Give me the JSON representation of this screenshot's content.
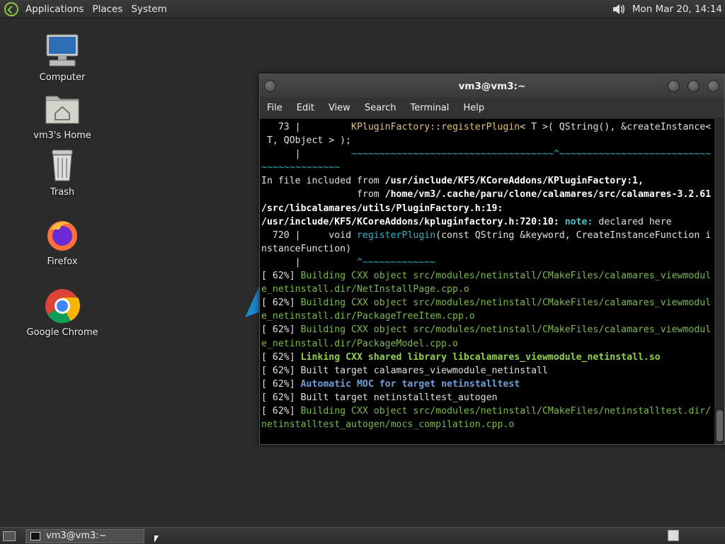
{
  "top_panel": {
    "menus": [
      "Applications",
      "Places",
      "System"
    ],
    "clock": "Mon Mar 20, 14:14"
  },
  "desktop": {
    "icons": [
      {
        "label": "Computer",
        "icon": "computer-icon"
      },
      {
        "label": "vm3's Home",
        "icon": "home-folder-icon"
      },
      {
        "label": "Trash",
        "icon": "trash-icon"
      },
      {
        "label": "Firefox",
        "icon": "firefox-icon"
      },
      {
        "label": "Google Chrome",
        "icon": "chrome-icon"
      }
    ]
  },
  "terminal": {
    "title": "vm3@vm3:~",
    "menu": [
      "File",
      "Edit",
      "View",
      "Search",
      "Terminal",
      "Help"
    ],
    "lines": [
      "   73 |         KPluginFactory::registerPlugin< T >( QString(), &createInstance<",
      " T, QObject > );",
      "      |         ~~~~~~~~~~~~~~~~~~~~~~~~~~~~~~~~~~~~^~~~~~~~~~~~~~~~~~~~~~~~~~~~",
      "~~~~~~~~~~~~~~",
      "In file included from /usr/include/KF5/KCoreAddons/KPluginFactory:1,",
      "                 from /home/vm3/.cache/paru/clone/calamares/src/calamares-3.2.61",
      "/src/libcalamares/utils/PluginFactory.h:19:",
      "/usr/include/KF5/KCoreAddons/kpluginfactory.h:720:10: note: declared here",
      "  720 |     void registerPlugin(const QString &keyword, CreateInstanceFunction i",
      "nstanceFunction)",
      "      |          ^~~~~~~~~~~~~~",
      "[ 62%] Building CXX object src/modules/netinstall/CMakeFiles/calamares_viewmodul",
      "e_netinstall.dir/NetInstallPage.cpp.o",
      "[ 62%] Building CXX object src/modules/netinstall/CMakeFiles/calamares_viewmodul",
      "e_netinstall.dir/PackageTreeItem.cpp.o",
      "[ 62%] Building CXX object src/modules/netinstall/CMakeFiles/calamares_viewmodul",
      "e_netinstall.dir/PackageModel.cpp.o",
      "[ 62%] Linking CXX shared library libcalamares_viewmodule_netinstall.so",
      "[ 62%] Built target calamares_viewmodule_netinstall",
      "[ 62%] Automatic MOC for target netinstalltest",
      "[ 62%] Built target netinstalltest_autogen",
      "[ 62%] Building CXX object src/modules/netinstall/CMakeFiles/netinstalltest.dir/",
      "netinstalltest_autogen/mocs_compilation.cpp.o"
    ]
  },
  "taskbar": {
    "task_label": "vm3@vm3:~"
  }
}
